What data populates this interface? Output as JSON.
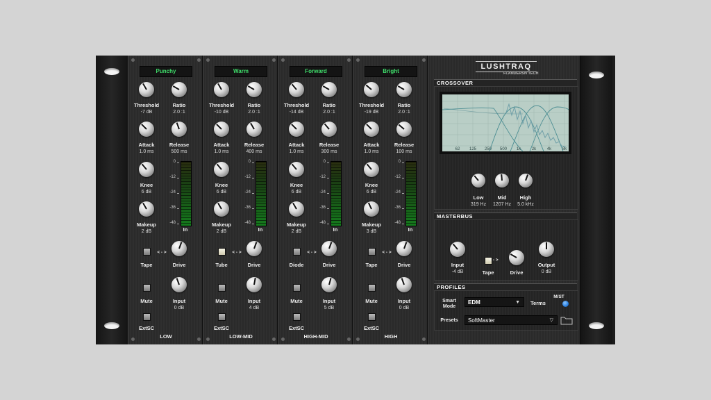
{
  "brand": {
    "name": "LUSHTRAQ",
    "sub": "FLANDERSN TECH"
  },
  "bands": [
    {
      "name": "LOW",
      "preset": "Punchy",
      "threshold": {
        "label": "Threshold",
        "value": "-7 dB"
      },
      "ratio": {
        "label": "Ratio",
        "value": "2.0 :1"
      },
      "attack": {
        "label": "Attack",
        "value": "1.0 ms"
      },
      "release": {
        "label": "Release",
        "value": "500 ms"
      },
      "knee": {
        "label": "Knee",
        "value": "6 dB"
      },
      "makeup": {
        "label": "Makeup",
        "value": "2 dB"
      },
      "meter_label": "In",
      "saturation": "Tape",
      "link_symbol": "< - >",
      "drive_label": "Drive",
      "mute_label": "Mute",
      "input": {
        "label": "Input",
        "value": "0 dB"
      },
      "extsc_label": "ExtSC",
      "sat_active": false
    },
    {
      "name": "LOW-MID",
      "preset": "Warm",
      "threshold": {
        "label": "Threshold",
        "value": "-10 dB"
      },
      "ratio": {
        "label": "Ratio",
        "value": "2.0 :1"
      },
      "attack": {
        "label": "Attack",
        "value": "1.0 ms"
      },
      "release": {
        "label": "Release",
        "value": "400 ms"
      },
      "knee": {
        "label": "Knee",
        "value": "6 dB"
      },
      "makeup": {
        "label": "Makeup",
        "value": "2 dB"
      },
      "meter_label": "In",
      "saturation": "Tube",
      "link_symbol": "< - >",
      "drive_label": "Drive",
      "mute_label": "Mute",
      "input": {
        "label": "Input",
        "value": "4 dB"
      },
      "extsc_label": "ExtSC",
      "sat_active": true
    },
    {
      "name": "HIGH-MID",
      "preset": "Forward",
      "threshold": {
        "label": "Threshold",
        "value": "-14 dB"
      },
      "ratio": {
        "label": "Ratio",
        "value": "2.0 :1"
      },
      "attack": {
        "label": "Attack",
        "value": "1.0 ms"
      },
      "release": {
        "label": "Release",
        "value": "300 ms"
      },
      "knee": {
        "label": "Knee",
        "value": "6 dB"
      },
      "makeup": {
        "label": "Makeup",
        "value": "2 dB"
      },
      "meter_label": "In",
      "saturation": "Diode",
      "link_symbol": "< - >",
      "drive_label": "Drive",
      "mute_label": "Mute",
      "input": {
        "label": "Input",
        "value": "5 dB"
      },
      "extsc_label": "ExtSC",
      "sat_active": false
    },
    {
      "name": "HIGH",
      "preset": "Bright",
      "threshold": {
        "label": "Threshold",
        "value": "-19 dB"
      },
      "ratio": {
        "label": "Ratio",
        "value": "2.0 :1"
      },
      "attack": {
        "label": "Attack",
        "value": "1.0 ms"
      },
      "release": {
        "label": "Release",
        "value": "100 ms"
      },
      "knee": {
        "label": "Knee",
        "value": "6 dB"
      },
      "makeup": {
        "label": "Makeup",
        "value": "3 dB"
      },
      "meter_label": "In",
      "saturation": "Tape",
      "link_symbol": "< - >",
      "drive_label": "Drive",
      "mute_label": "Mute",
      "input": {
        "label": "Input",
        "value": "0 dB"
      },
      "extsc_label": "ExtSC",
      "sat_active": false
    }
  ],
  "meter_scale": [
    "0",
    "-12",
    "-24",
    "-36",
    "-48"
  ],
  "crossover": {
    "title": "CROSSOVER",
    "freq_labels": [
      "62",
      "125",
      "250",
      "500",
      "1k",
      "2k",
      "4k",
      "8k"
    ],
    "low": {
      "label": "Low",
      "value": "319 Hz"
    },
    "mid": {
      "label": "Mid",
      "value": "1207 Hz"
    },
    "high": {
      "label": "High",
      "value": "5.0 kHz"
    }
  },
  "masterbus": {
    "title": "MASTERBUS",
    "input": {
      "label": "Input",
      "value": "-4 dB"
    },
    "tape_label": "Tape",
    "link_symbol": "< - >",
    "drive_label": "Drive",
    "output": {
      "label": "Output",
      "value": "0 dB"
    }
  },
  "profiles": {
    "title": "PROFILES",
    "smart_mode_label_1": "Smart",
    "smart_mode_label_2": "Mode",
    "smart_mode_value": "EDM",
    "terms_label": "Terms",
    "mst_label": "M/ST",
    "presets_label": "Presets",
    "preset_value": "SoftMaster"
  },
  "colors": {
    "lcd_text": "#3fdc6a",
    "graph_bg": "#b9cec6",
    "mst_led": "#2a7fe0"
  },
  "icons": {
    "dropdown": "▼",
    "dropdown_outline": "▽",
    "folder": "folder-icon"
  }
}
